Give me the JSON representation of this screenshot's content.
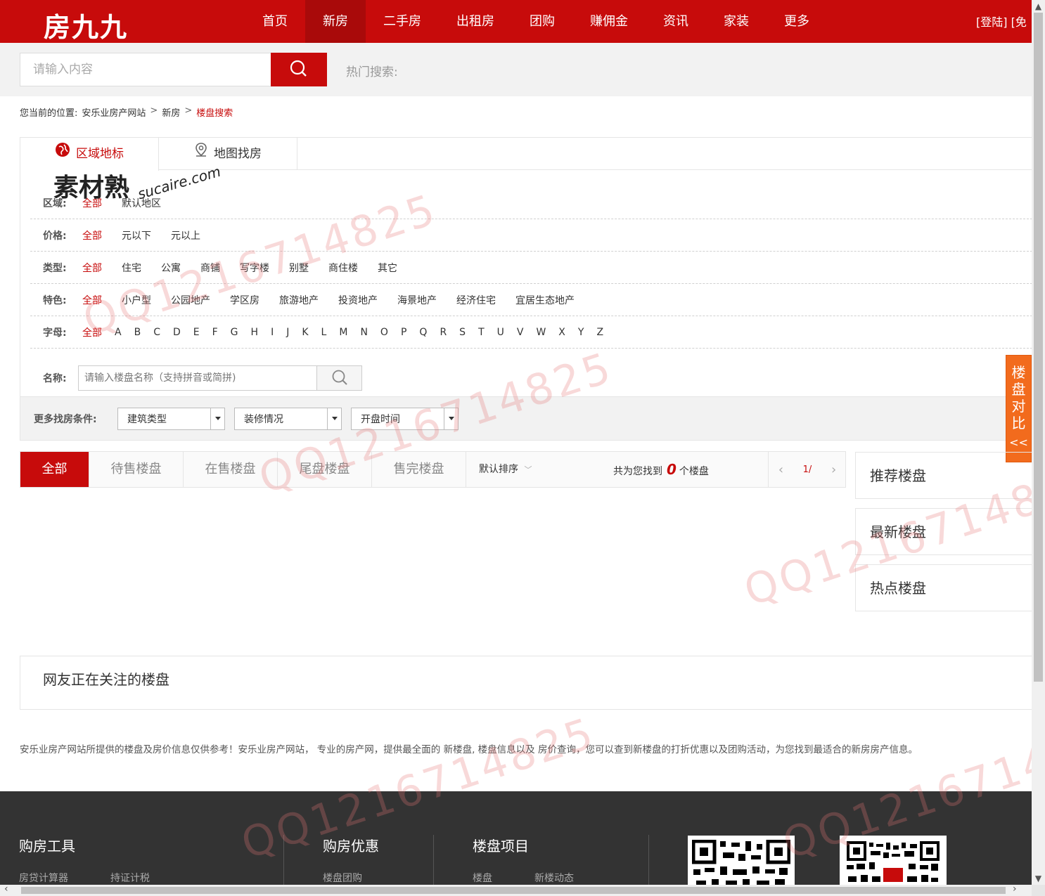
{
  "header": {
    "logo": "房九九",
    "nav": [
      "首页",
      "新房",
      "二手房",
      "出租房",
      "团购",
      "赚佣金",
      "资讯",
      "家装",
      "更多"
    ],
    "active_nav": 1,
    "login": "[登陆] [免"
  },
  "search": {
    "placeholder": "请输入内容",
    "hot_label": "热门搜索:"
  },
  "breadcrumb": {
    "label": "您当前的位置:",
    "items": [
      "安乐业房产网站",
      "新房",
      "楼盘搜索"
    ],
    "separator": ">"
  },
  "panel_tabs": [
    "区域地标",
    "地图找房"
  ],
  "filters": {
    "area": {
      "label": "区域:",
      "options": [
        "全部",
        "默认地区"
      ]
    },
    "price": {
      "label": "价格:",
      "options": [
        "全部",
        "元以下",
        "元以上"
      ]
    },
    "type": {
      "label": "类型:",
      "options": [
        "全部",
        "住宅",
        "公寓",
        "商铺",
        "写字楼",
        "别墅",
        "商住楼",
        "其它"
      ]
    },
    "feature": {
      "label": "特色:",
      "options": [
        "全部",
        "小户型",
        "公园地产",
        "学区房",
        "旅游地产",
        "投资地产",
        "海景地产",
        "经济住宅",
        "宜居生态地产"
      ]
    },
    "letter": {
      "label": "字母:",
      "options": [
        "全部",
        "A",
        "B",
        "C",
        "D",
        "E",
        "F",
        "G",
        "H",
        "I",
        "J",
        "K",
        "L",
        "M",
        "N",
        "O",
        "P",
        "Q",
        "R",
        "S",
        "T",
        "U",
        "V",
        "W",
        "X",
        "Y",
        "Z"
      ]
    },
    "name": {
      "label": "名称:",
      "placeholder": "请输入楼盘名称（支持拼音或简拼)"
    },
    "more": {
      "label": "更多找房条件:",
      "dropdowns": [
        "建筑类型",
        "装修情况",
        "开盘时间"
      ]
    }
  },
  "compare": {
    "chars": [
      "楼",
      "盘",
      "对",
      "比"
    ],
    "collapse": "<<"
  },
  "status_tabs": [
    "全部",
    "待售楼盘",
    "在售楼盘",
    "尾盘楼盘",
    "售完楼盘"
  ],
  "sort": "默认排序",
  "found": {
    "prefix": "共为您找到",
    "count": "0",
    "suffix": "个楼盘"
  },
  "pager": {
    "text": "1/",
    "prev": "‹",
    "next": "›"
  },
  "side_boxes": [
    "推荐楼盘",
    "最新楼盘",
    "热点楼盘"
  ],
  "attention_title": "网友正在关注的楼盘",
  "disclaimer": "安乐业房产网站所提供的楼盘及房价信息仅供参考！安乐业房产网站， 专业的房产网，提供最全面的 新楼盘, 楼盘信息以及 房价查询，您可以查到新楼盘的打折优惠以及团购活动，为您找到最适合的新房房产信息。",
  "footer": {
    "columns": [
      {
        "title": "购房工具",
        "sub": [
          "房贷计算器",
          "持证计税"
        ]
      },
      {
        "title": "购房优惠",
        "sub": [
          "楼盘团购"
        ]
      },
      {
        "title": "楼盘项目",
        "sub": [
          "楼盘",
          "新楼动态"
        ]
      }
    ]
  },
  "watermarks": {
    "text": "QQ1216714825",
    "stamp_cn": "素材熟",
    "stamp_en": "sucaire.com"
  },
  "colors": {
    "brand": "#c70b0b",
    "compare": "#f26b1d",
    "footer": "#333333"
  }
}
